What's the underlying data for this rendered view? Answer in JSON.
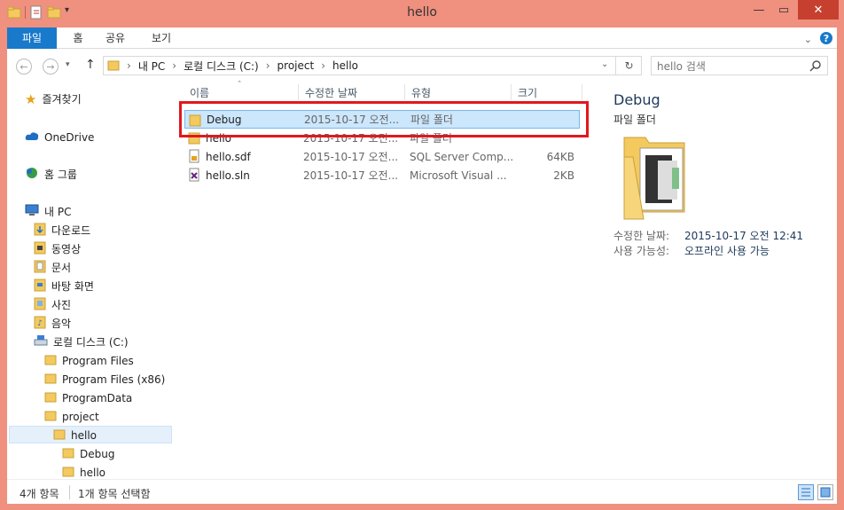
{
  "window": {
    "title": "hello"
  },
  "ribbon": {
    "tabs": [
      "파일",
      "홈",
      "공유",
      "보기"
    ]
  },
  "address": {
    "crumbs": [
      "내 PC",
      "로컬 디스크 (C:)",
      "project",
      "hello"
    ],
    "search_placeholder": "hello 검색"
  },
  "nav": {
    "favorites": "즐겨찾기",
    "onedrive": "OneDrive",
    "homegroup": "홈 그룹",
    "thispc": "내 PC",
    "items": [
      "다운로드",
      "동영상",
      "문서",
      "바탕 화면",
      "사진",
      "음악",
      "로컬 디스크 (C:)",
      "Program Files",
      "Program Files (x86)",
      "ProgramData",
      "project",
      "hello",
      "Debug",
      "hello"
    ]
  },
  "columns": {
    "name": "이름",
    "date": "수정한 날짜",
    "type": "유형",
    "size": "크기"
  },
  "files": [
    {
      "name": "Debug",
      "date": "2015-10-17 오전...",
      "type": "파일 폴더",
      "size": ""
    },
    {
      "name": "hello",
      "date": "2015-10-17 오전...",
      "type": "파일 폴더",
      "size": ""
    },
    {
      "name": "hello.sdf",
      "date": "2015-10-17 오전...",
      "type": "SQL Server Comp...",
      "size": "64KB"
    },
    {
      "name": "hello.sln",
      "date": "2015-10-17 오전...",
      "type": "Microsoft Visual ...",
      "size": "2KB"
    }
  ],
  "preview": {
    "name": "Debug",
    "kind": "파일 폴더",
    "modified_label": "수정한 날짜:",
    "modified_value": "2015-10-17 오전 12:41",
    "availability_label": "사용 가능성:",
    "availability_value": "오프라인 사용 가능"
  },
  "status": {
    "count": "4개 항목",
    "selected": "1개 항목 선택함"
  },
  "colors": {
    "accent": "#1979ca",
    "titlebar": "#f0907f",
    "highlight": "#e0181d"
  }
}
